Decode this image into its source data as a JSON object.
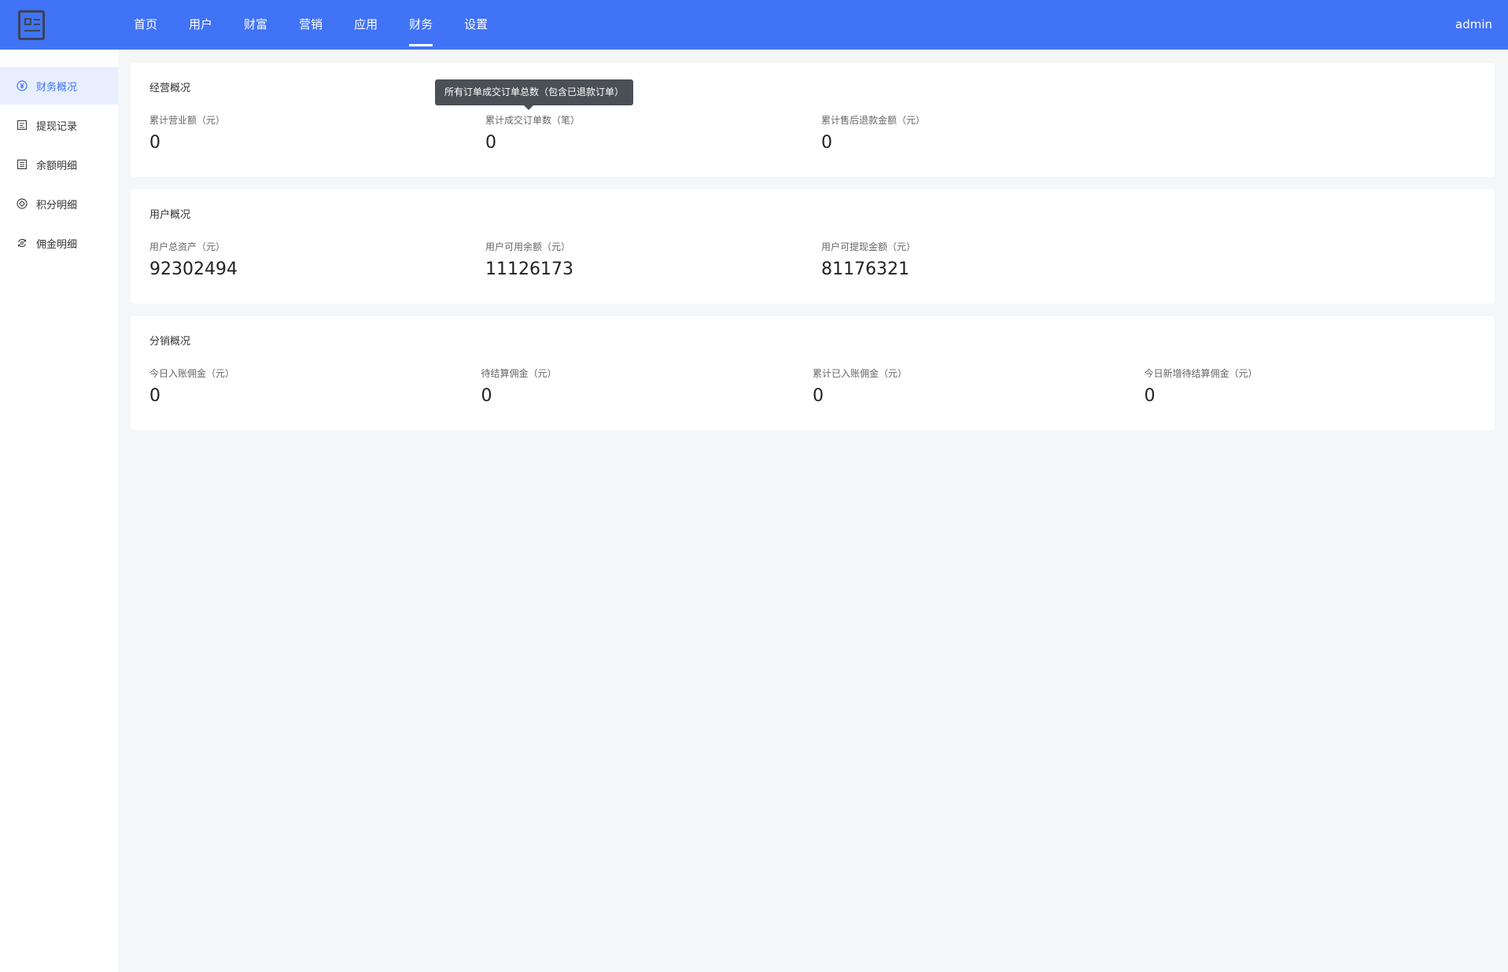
{
  "header": {
    "nav": [
      {
        "label": "首页",
        "active": false
      },
      {
        "label": "用户",
        "active": false
      },
      {
        "label": "财富",
        "active": false
      },
      {
        "label": "营销",
        "active": false
      },
      {
        "label": "应用",
        "active": false
      },
      {
        "label": "财务",
        "active": true
      },
      {
        "label": "设置",
        "active": false
      }
    ],
    "user": "admin"
  },
  "sidebar": {
    "items": [
      {
        "label": "财务概况",
        "icon": "yen-circle-icon",
        "active": true
      },
      {
        "label": "提现记录",
        "icon": "record-icon",
        "active": false
      },
      {
        "label": "余额明细",
        "icon": "list-icon",
        "active": false
      },
      {
        "label": "积分明细",
        "icon": "points-icon",
        "active": false
      },
      {
        "label": "佣金明细",
        "icon": "commission-icon",
        "active": false
      }
    ]
  },
  "tooltip": {
    "text": "所有订单成交订单总数（包含已退款订单）"
  },
  "cards": [
    {
      "title": "经营概况",
      "stats": [
        {
          "label": "累计营业额（元）",
          "value": "0"
        },
        {
          "label": "累计成交订单数（笔）",
          "value": "0"
        },
        {
          "label": "累计售后退款金额（元）",
          "value": "0"
        }
      ]
    },
    {
      "title": "用户概况",
      "stats": [
        {
          "label": "用户总资产（元）",
          "value": "92302494"
        },
        {
          "label": "用户可用余额（元）",
          "value": "11126173"
        },
        {
          "label": "用户可提现金额（元）",
          "value": "81176321"
        }
      ]
    },
    {
      "title": "分销概况",
      "stats": [
        {
          "label": "今日入账佣金（元）",
          "value": "0"
        },
        {
          "label": "待结算佣金（元）",
          "value": "0"
        },
        {
          "label": "累计已入账佣金（元）",
          "value": "0"
        },
        {
          "label": "今日新增待结算佣金（元）",
          "value": "0"
        }
      ]
    }
  ],
  "colors": {
    "primary": "#4173f7",
    "sidebar_active_bg": "#e8eefd",
    "page_bg": "#f5f6f8",
    "tooltip_bg": "#4b4f56"
  }
}
